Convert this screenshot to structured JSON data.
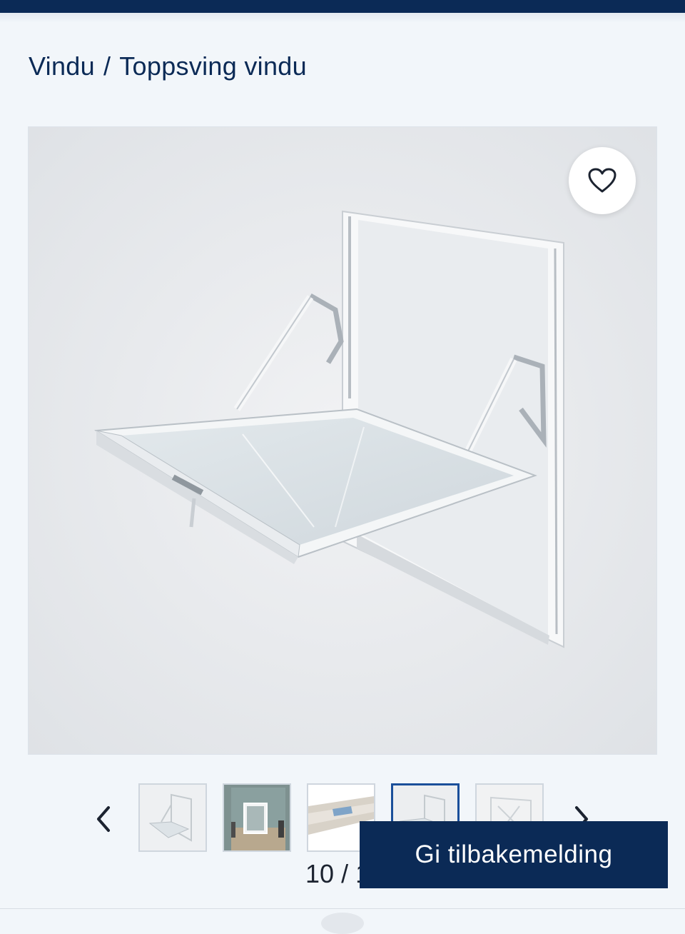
{
  "breadcrumb": {
    "category": "Vindu",
    "separator": "/",
    "current": "Toppsving vindu"
  },
  "gallery": {
    "current_index": "10",
    "separator": "/",
    "total": "11",
    "favorite_icon": "heart-icon",
    "prev_icon": "chevron-left-icon",
    "next_icon": "chevron-right-icon"
  },
  "feedback": {
    "label": "Gi tilbakemelding"
  },
  "colors": {
    "brand": "#0b2a56",
    "active_thumb": "#1b4f9a",
    "background": "#f2f6fa"
  }
}
